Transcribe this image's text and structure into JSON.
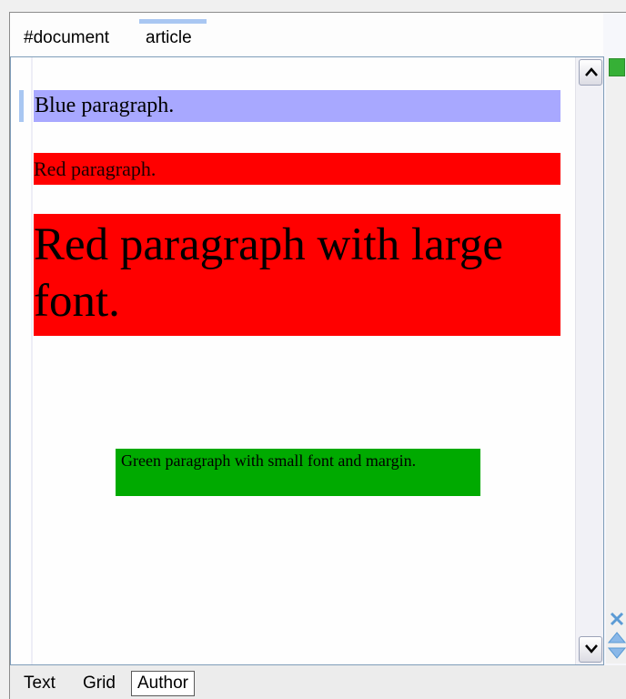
{
  "breadcrumb": {
    "items": [
      "#document",
      "article"
    ]
  },
  "editor": {
    "paragraphs": {
      "blue": "Blue paragraph.",
      "red": "Red paragraph.",
      "red_large": "Red paragraph with large font.",
      "green": "Green paragraph with small font and margin."
    },
    "colors": {
      "blue": "#a8a8ff",
      "red": "#ff0000",
      "green": "#00aa00"
    }
  },
  "scrollbar": {
    "up_icon": "chevron-up-icon",
    "down_icon": "chevron-down-icon"
  },
  "side_panel": {
    "status_color": "#36b036",
    "close_icon": "close-icon",
    "move_icon": "move-up-down-icon"
  },
  "tabs": [
    {
      "label": "Text",
      "active": false
    },
    {
      "label": "Grid",
      "active": false
    },
    {
      "label": "Author",
      "active": true
    }
  ]
}
